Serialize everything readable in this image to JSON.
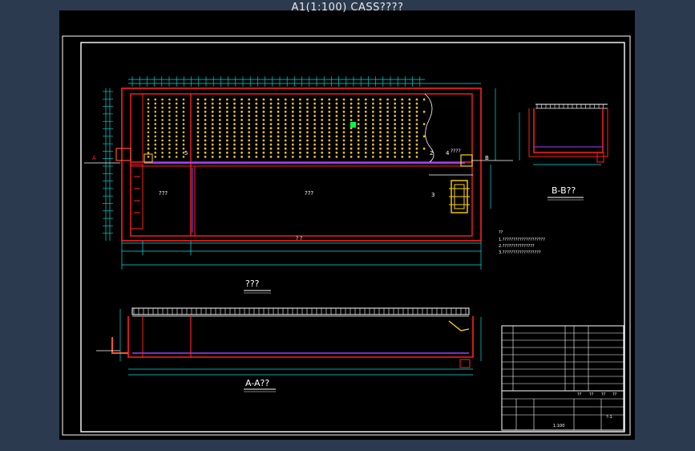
{
  "title": "A1(1:100) CASS????",
  "views": {
    "plan": {
      "label": "???"
    },
    "section_aa": {
      "label": "A-A??"
    },
    "section_bb": {
      "label": "B-B??"
    }
  },
  "plan_labels": {
    "room_left": "???",
    "room_center": "???",
    "bottom_note": "? ?",
    "callout_2": "2",
    "callout_3": "3",
    "callout_4": "4",
    "callout_5": "5",
    "callout_4_text": "????",
    "section_mark_a": "A",
    "section_mark_b": "B"
  },
  "notes": {
    "heading": "??",
    "lines": [
      "1.????????????????????",
      "2.???????????????",
      "3.??????????????????"
    ]
  },
  "title_block": {
    "header_cells": [
      "??",
      "??",
      "??",
      "??"
    ],
    "drawing_no": "?-1",
    "scale": "1:100"
  },
  "colors": {
    "sheet": "#000000",
    "frame": "#ffffff",
    "wall": "#ff2020",
    "dimension": "#00e0e0",
    "aerator": "#e8c020",
    "pipe": "#9a40ff",
    "highlight": "#00ff40",
    "equipment": "#ffd400"
  }
}
